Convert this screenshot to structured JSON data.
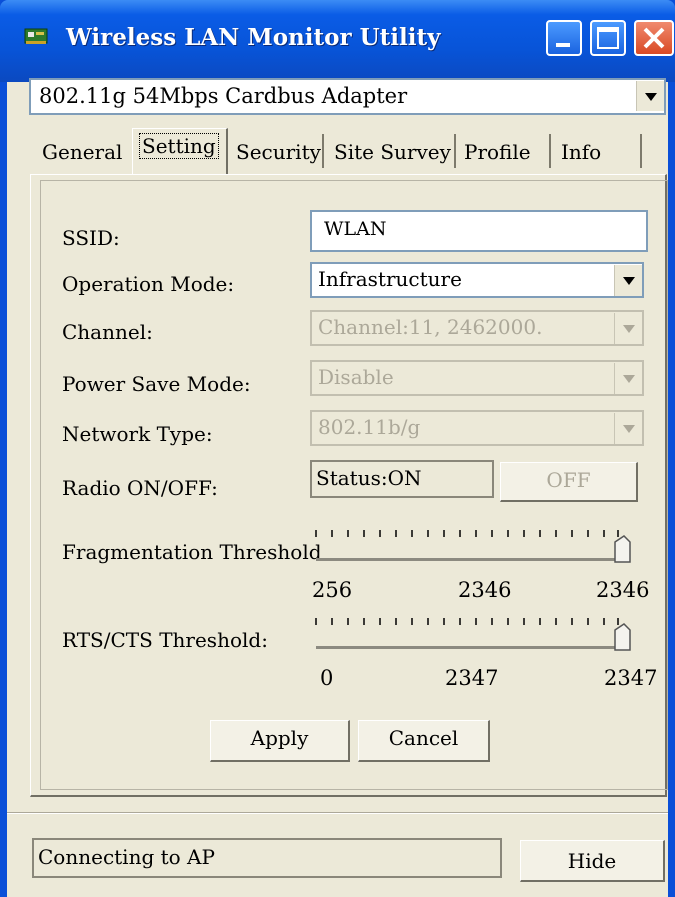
{
  "window": {
    "title": "Wireless LAN Monitor Utility"
  },
  "adapter": {
    "selected": "802.11g 54Mbps Cardbus Adapter"
  },
  "tabs": [
    "General",
    "Setting",
    "Security",
    "Site Survey",
    "Profile",
    "Info"
  ],
  "active_tab": "Setting",
  "settings": {
    "ssid_label": "SSID:",
    "ssid_value": "WLAN",
    "operation_mode_label": "Operation Mode:",
    "operation_mode_value": "Infrastructure",
    "channel_label": "Channel:",
    "channel_value": "Channel:11, 2462000.",
    "power_save_label": "Power Save Mode:",
    "power_save_value": "Disable",
    "network_type_label": "Network Type:",
    "network_type_value": "802.11b/g",
    "radio_label": "Radio ON/OFF:",
    "radio_status": "Status:ON",
    "radio_button": "OFF"
  },
  "fragmentation": {
    "label": "Fragmentation Threshold",
    "min": "256",
    "current": "2346",
    "max": "2346"
  },
  "rts": {
    "label": "RTS/CTS Threshold:",
    "min": "0",
    "current": "2347",
    "max": "2347"
  },
  "buttons": {
    "apply": "Apply",
    "cancel": "Cancel",
    "hide": "Hide"
  },
  "status": {
    "text": "Connecting to AP"
  },
  "colors": {
    "titlebar": "#0854d8",
    "client": "#ece9d8",
    "close_button": "#d94a25"
  }
}
